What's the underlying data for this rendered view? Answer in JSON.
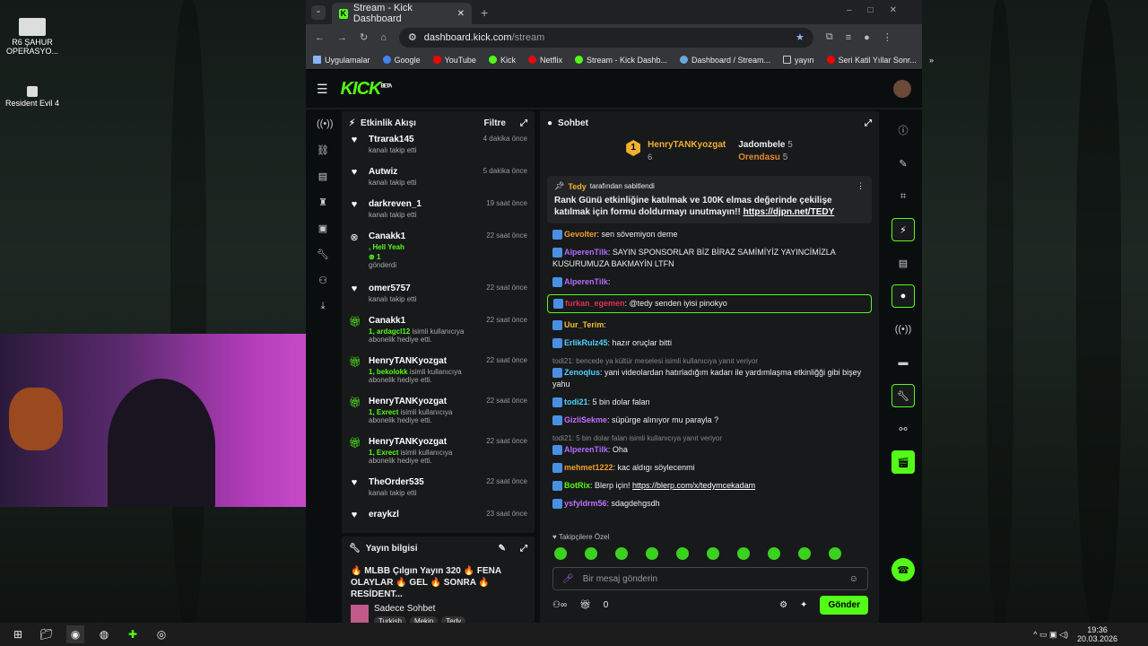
{
  "desktop": {
    "icons": [
      {
        "label": "R6 ŞAHUR OPERASYO..."
      },
      {
        "label": "Resident Evil 4"
      }
    ]
  },
  "browser": {
    "tab_title": "Stream - Kick Dashboard",
    "url_host": "dashboard.kick.com",
    "url_path": "/stream",
    "bookmarks": [
      "Uygulamalar",
      "Google",
      "YouTube",
      "Kick",
      "Netflix",
      "Stream - Kick Dashb...",
      "Dashboard / Stream...",
      "yayın",
      "Seri Katil Yıllar Sonr..."
    ]
  },
  "kick": {
    "logo": "KICK",
    "logo_sup": "BETA"
  },
  "activity": {
    "title": "Etkinlik Akışı",
    "filter": "Filtre",
    "events": [
      {
        "icon": "heart",
        "name": "Ttrarak145",
        "sub": "kanalı takip etti",
        "time": "4 dakika önce"
      },
      {
        "icon": "heart",
        "name": "Autwiz",
        "sub": "kanalı takip etti",
        "time": "5 dakika önce"
      },
      {
        "icon": "heart",
        "name": "darkreven_1",
        "sub": "kanalı takip etti",
        "time": "19 saat önce"
      },
      {
        "icon": "kick",
        "name": "Canakk1",
        "hl": ", Hell Yeah",
        "extra": "1",
        "sub": "gönderdi",
        "time": "22 saat önce"
      },
      {
        "icon": "heart",
        "name": "omer5757",
        "sub": "kanalı takip etti",
        "time": "22 saat önce"
      },
      {
        "icon": "gift",
        "name": "Canakk1",
        "hl": "1, ardagcl12",
        "sub": " isimli kullanıcıya abonelik hediye etti.",
        "time": "22 saat önce"
      },
      {
        "icon": "gift",
        "name": "HenryTANKyozgat",
        "hl": "1, bekolokk",
        "sub": " isimli kullanıcıya abonelik hediye etti.",
        "time": "22 saat önce"
      },
      {
        "icon": "gift",
        "name": "HenryTANKyozgat",
        "hl": "1, Exrect",
        "sub": " isimli kullanıcıya abonelik hediye etti.",
        "time": "22 saat önce"
      },
      {
        "icon": "gift",
        "name": "HenryTANKyozgat",
        "hl": "1, Exrect",
        "sub": " isimli kullanıcıya abonelik hediye etti.",
        "time": "22 saat önce"
      },
      {
        "icon": "heart",
        "name": "TheOrder535",
        "sub": "kanalı takip etti",
        "time": "22 saat önce"
      },
      {
        "icon": "heart",
        "name": "eraykzl",
        "sub": "",
        "time": "23 saat önce"
      }
    ]
  },
  "stream_info": {
    "title": "Yayın bilgisi",
    "stream_title": "🔥 MLBB Çılgın Yayın 320 🔥 FENA OLAYLAR 🔥 GEL 🔥 SONRA 🔥 RESİDENT...",
    "category": "Sadece Sohbet",
    "tags": [
      "Turkish",
      "Mekip",
      "Tedy"
    ]
  },
  "chat": {
    "title": "Sohbet",
    "leaders": [
      {
        "rank": "1",
        "name": "HenryTANKyozgat",
        "count": "6"
      },
      {
        "name": "Jadombele",
        "count": "5"
      },
      {
        "name": "Orendasu",
        "count": "5"
      }
    ],
    "pinned": {
      "by": "Tedy",
      "by_suffix": "tarafından sabitlendi",
      "text": "Rank Günü etkinliğine katılmak ve 100K elmas değerinde çekilişe katılmak için formu doldurmayı unutmayın!!",
      "link": "https://djpn.net/TEDY"
    },
    "messages": [
      {
        "user": "Gevolter",
        "color": "#f0a030",
        "text": ": sen sövemiyon deme"
      },
      {
        "user": "AlperenTilk",
        "color": "#b06cff",
        "text": ": SAYIN SPONSORLAR BİZ BİRAZ SAMİMİYİZ YAYINCİMİZLA KUSURUMUZA BAKMAYİN LTFN"
      },
      {
        "user": "AlperenTilk",
        "color": "#b06cff",
        "text": ":"
      },
      {
        "user": "furkan_egemen",
        "color": "#e03050",
        "text": ": @tedy senden iyisi pinokyo",
        "hl": true
      },
      {
        "user": "Uur_Terim",
        "color": "#f0c030",
        "text": ":"
      },
      {
        "user": "ErlikRulz45",
        "color": "#50d0ff",
        "text": ": hazır oruçlar bitti"
      },
      {
        "reply": "todi21: bencede ya kültür meselesi isimli kullanıcıya yanıt veriyor",
        "user": "Zenoqlus",
        "color": "#50d0ff",
        "text": ": yani videolardan hatırladığım kadarı ile yardımlaşma etkinliğği gibi bişey yahu"
      },
      {
        "user": "todi21",
        "color": "#50d0ff",
        "text": ": 5 bin dolar falan"
      },
      {
        "user": "GizliSekme",
        "color": "#c070ff",
        "text": ": süpürge alınıyor mu parayla ?"
      },
      {
        "reply": "todi21: 5 bin dolar falan isimli kullanıcıya yanıt veriyor",
        "user": "AlperenTilk",
        "color": "#b06cff",
        "text": ": Oha"
      },
      {
        "user": "mehmet1222",
        "color": "#f0a030",
        "text": ": kac aldıgı söylecenmi"
      },
      {
        "user": "BotRix",
        "color": "#53fc18",
        "text": ": Blerp için! ",
        "link": "https://blerp.com/x/tedymcekadam"
      },
      {
        "user": "ysfyldrm56",
        "color": "#c070ff",
        "text": ": sdagdehgsdh"
      }
    ],
    "followers_only": "Takipçilere Özel",
    "input_placeholder": "Bir mesaj gönderin",
    "send": "Gönder",
    "count": "0"
  },
  "taskbar": {
    "time": "19:36",
    "date": "20.03.2026"
  }
}
